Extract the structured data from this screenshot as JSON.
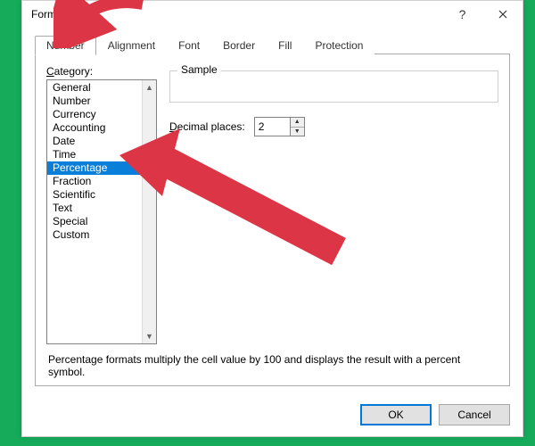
{
  "window": {
    "title": "Format Cells"
  },
  "tabs": [
    "Number",
    "Alignment",
    "Font",
    "Border",
    "Fill",
    "Protection"
  ],
  "active_tab_index": 0,
  "category": {
    "label": "Category:",
    "items": [
      "General",
      "Number",
      "Currency",
      "Accounting",
      "Date",
      "Time",
      "Percentage",
      "Fraction",
      "Scientific",
      "Text",
      "Special",
      "Custom"
    ],
    "selected_index": 6
  },
  "sample": {
    "label": "Sample",
    "value": ""
  },
  "decimal": {
    "label": "Decimal places:",
    "value": "2"
  },
  "description": "Percentage formats multiply the cell value by 100 and displays the result with a percent symbol.",
  "buttons": {
    "ok": "OK",
    "cancel": "Cancel"
  },
  "colors": {
    "accent": "#0078d7",
    "arrow": "#dc3545"
  }
}
